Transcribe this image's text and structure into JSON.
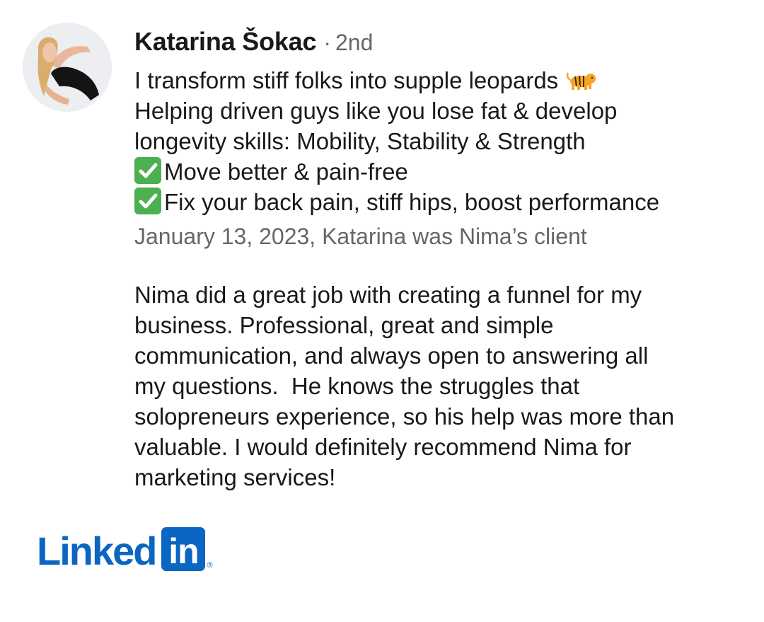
{
  "profile": {
    "name": "Katarina Šokac",
    "degree_separator": "·",
    "degree": "2nd",
    "headline_lines": [
      "I transform stiff folks into supple leopards",
      "Helping driven guys like you lose fat & develop",
      "longevity skills: Mobility, Stability & Strength",
      "Move better & pain-free",
      "Fix your back pain, stiff hips, boost performance"
    ],
    "avatar_icon": "profile-photo"
  },
  "recommendation": {
    "meta": "January 13, 2023, Katarina was Nima’s client",
    "body_lines": [
      "Nima did a great job with creating a funnel for my",
      "business. Professional, great and simple",
      "communication, and always open to answering all",
      "my questions.  He knows the struggles that",
      "solopreneurs experience, so his help was more than",
      "valuable. I would definitely recommend Nima for",
      "marketing services!"
    ]
  },
  "brand": {
    "logo_word": "Linked",
    "logo_box": "in",
    "logo_reg": "®",
    "color": "#0a66c2"
  },
  "icons": {
    "tiger": "tiger-emoji-icon",
    "check": "check-mark-button-icon"
  }
}
